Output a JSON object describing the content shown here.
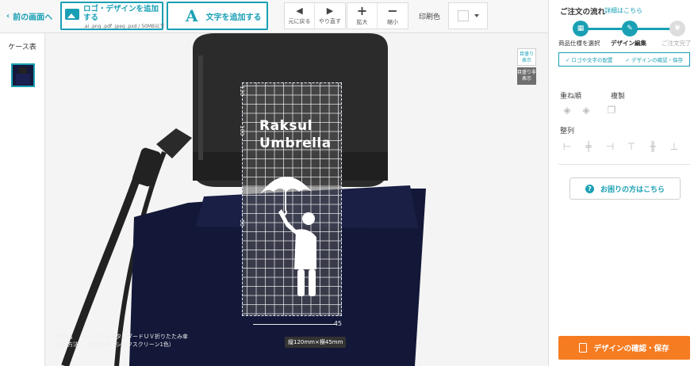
{
  "toolbar": {
    "back_label": "前の画面へ",
    "logo_button_label": "ロゴ・デザインを追加する",
    "logo_button_note": ".ai .png .pdf .jpeg .psd / 50MB以下",
    "text_button_glyph": "A",
    "text_button_label": "文字を追加する",
    "undo_label": "元に戻る",
    "redo_label": "やり直す",
    "zoom_in_label": "拡大",
    "zoom_out_label": "縮小",
    "print_color_label": "印刷色",
    "print_color_value": "#ffffff"
  },
  "left_panel": {
    "title": "ケース表"
  },
  "canvas": {
    "design_text_line1": "Raksul",
    "design_text_line2": "Umbrella",
    "ruler_v": [
      "120",
      "100",
      "50"
    ],
    "ruler_h_value": "45",
    "size_tag": "縦120mm×横45mm",
    "grid_show": "目盛り表示",
    "grid_hide": "目盛り非表示",
    "product_name_label": "商品名",
    "product_name_value": "オリジナルスタンダードＵＶ折りたたみ傘",
    "print_method_label": "印刷方法",
    "print_method_value": "単色印刷（シルクスクリーン1色）"
  },
  "right_panel": {
    "flow_title": "ご注文の流れ",
    "flow_link": "詳細はこちら",
    "steps": [
      {
        "label": "商品仕様を選択",
        "state": "done"
      },
      {
        "label": "デザイン編集",
        "state": "current"
      },
      {
        "label": "ご注文完了",
        "state": "todo"
      }
    ],
    "substeps": [
      "✓ ロゴや文字の配置",
      "✓ デザインの確認・保存"
    ],
    "layer_order_label": "重ね順",
    "duplicate_label": "複製",
    "align_label": "整列",
    "help_button_label": "お困りの方はこちら",
    "confirm_button_label": "デザインの確認・保存",
    "accent_color": "#1aa0b5",
    "confirm_color": "#f57c21"
  }
}
